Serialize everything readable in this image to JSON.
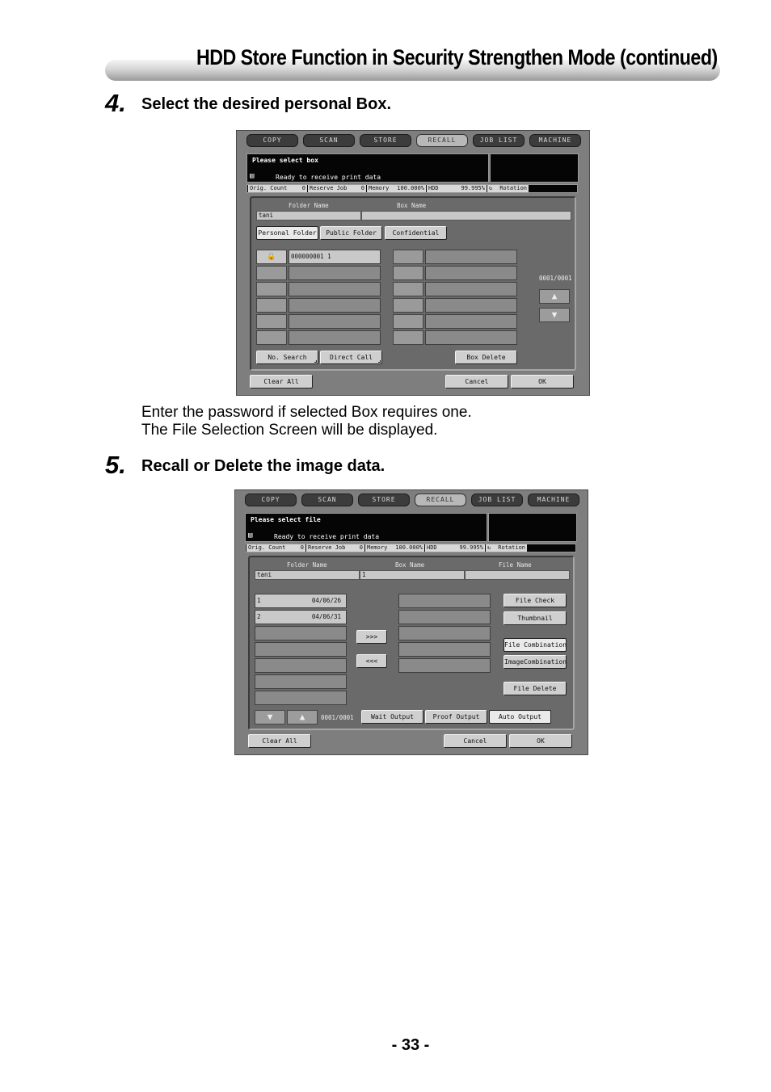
{
  "page": {
    "title": "HDD Store Function in Security Strengthen Mode (continued)",
    "page_number": "- 33 -"
  },
  "steps": [
    {
      "num": "4.",
      "text": "Select the desired personal Box."
    },
    {
      "num": "5.",
      "text": "Recall or Delete the image data."
    }
  ],
  "step4_note": {
    "line1": "Enter the password if selected Box requires one.",
    "line2": "The File Selection Screen will be displayed."
  },
  "tabs": [
    "COPY",
    "SCAN",
    "STORE",
    "RECALL",
    "JOB LIST",
    "MACHINE"
  ],
  "active_tab": "RECALL",
  "status": {
    "ready": "Ready to receive print data",
    "orig_count_label": "Orig. Count",
    "orig_count_value": "0",
    "reserve_job_label": "Reserve Job",
    "reserve_job_value": "0",
    "memory_label": "Memory",
    "memory_value": "100.000%",
    "hdd_label": "HDD",
    "hdd_value": "99.995%",
    "rotation": "Rotation"
  },
  "screen1": {
    "message": "Please select box",
    "folder_name_header": "Folder Name",
    "box_name_header": "Box Name",
    "folder_value": "tani",
    "folder_tabs": [
      "Personal Folder",
      "Public Folder",
      "Confidential"
    ],
    "box_entry": "000000001 1",
    "counter": "0001/0001",
    "bottom_buttons": [
      "No. Search",
      "Direct Call",
      "Box Delete"
    ],
    "clear_all": "Clear All",
    "cancel": "Cancel",
    "ok": "OK"
  },
  "screen2": {
    "message": "Please select file",
    "folder_name_header": "Folder Name",
    "box_name_header": "Box Name",
    "file_name_header": "File Name",
    "folder_value": "tani",
    "box_value": "1",
    "files": [
      {
        "name": "1",
        "date": "04/06/26"
      },
      {
        "name": "2",
        "date": "04/06/31"
      }
    ],
    "move_right": ">>>",
    "move_left": "<<<",
    "side_buttons": [
      "File Check",
      "Thumbnail",
      "File Combination",
      "ImageCombination",
      "File Delete"
    ],
    "counter": "0001/0001",
    "output_buttons": [
      "Wait Output",
      "Proof Output",
      "Auto Output"
    ],
    "clear_all": "Clear All",
    "cancel": "Cancel",
    "ok": "OK"
  }
}
